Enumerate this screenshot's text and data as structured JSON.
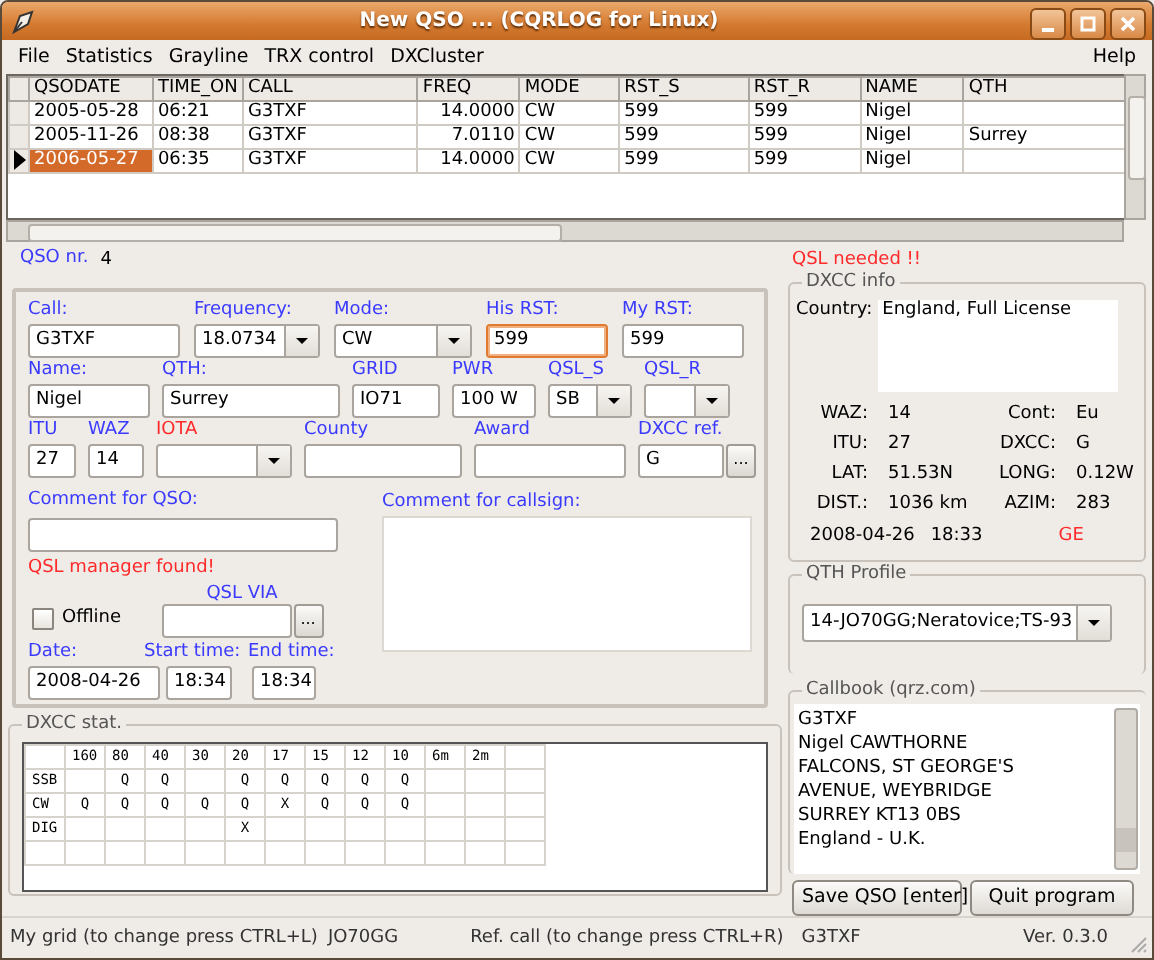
{
  "window": {
    "title": "New QSO ... (CQRLOG for Linux)"
  },
  "menu": {
    "items": [
      "File",
      "Statistics",
      "Grayline",
      "TRX control",
      "DXCluster"
    ],
    "right_items": [
      "Help"
    ]
  },
  "log_table": {
    "columns": [
      "QSODATE",
      "TIME_ON",
      "CALL",
      "FREQ",
      "MODE",
      "RST_S",
      "RST_R",
      "NAME",
      "QTH"
    ],
    "rows": [
      {
        "selected": false,
        "cells": [
          "2005-05-28",
          "06:21",
          "G3TXF",
          "14.0000",
          "CW",
          "599",
          "599",
          "Nigel",
          null
        ]
      },
      {
        "selected": false,
        "cells": [
          "2005-11-26",
          "08:38",
          "G3TXF",
          "7.0110",
          "CW",
          "599",
          "599",
          "Nigel",
          "Surrey"
        ]
      },
      {
        "selected": true,
        "cells": [
          "2006-05-27",
          "06:35",
          "G3TXF",
          "14.0000",
          "CW",
          "599",
          "599",
          "Nigel",
          null
        ]
      }
    ]
  },
  "qso_nr": {
    "label": "QSO nr.",
    "value": "4"
  },
  "qsl_notice": "QSL needed !!",
  "form": {
    "fields": [
      {
        "label": "Call:",
        "value": "G3TXF",
        "kind": "text",
        "focused": false,
        "warning": false
      },
      {
        "label": "Frequency:",
        "value": "18.0734",
        "kind": "combo",
        "focused": false,
        "warning": false
      },
      {
        "label": "Mode:",
        "value": "CW",
        "kind": "combo",
        "focused": false,
        "warning": false
      },
      {
        "label": "His RST:",
        "value": "599",
        "kind": "text",
        "focused": true,
        "warning": false
      },
      {
        "label": "My RST:",
        "value": "599",
        "kind": "text",
        "focused": false,
        "warning": false
      },
      {
        "label": "Name:",
        "value": "Nigel",
        "kind": "text",
        "focused": false,
        "warning": false
      },
      {
        "label": "QTH:",
        "value": "Surrey",
        "kind": "text",
        "focused": false,
        "warning": false
      },
      {
        "label": "GRID",
        "value": "IO71",
        "kind": "text",
        "focused": false,
        "warning": false
      },
      {
        "label": "PWR",
        "value": "100 W",
        "kind": "text",
        "focused": false,
        "warning": false
      },
      {
        "label": "QSL_S",
        "value": "SB",
        "kind": "combo",
        "focused": false,
        "warning": false
      },
      {
        "label": "QSL_R",
        "kind": "combo",
        "focused": false,
        "warning": false
      },
      {
        "label": "ITU",
        "value": "27",
        "kind": "text",
        "focused": false,
        "warning": false
      },
      {
        "label": "WAZ",
        "value": "14",
        "kind": "text",
        "focused": false,
        "warning": false
      },
      {
        "label": "IOTA",
        "kind": "combo",
        "focused": false,
        "warning": true
      },
      {
        "label": "County",
        "kind": "text",
        "focused": false,
        "warning": false
      },
      {
        "label": "Award",
        "kind": "text",
        "focused": false,
        "warning": false
      },
      {
        "label": "DXCC ref.",
        "value": "G",
        "kind": "picker",
        "button": "...",
        "focused": false,
        "warning": false
      }
    ],
    "comment_qso": {
      "label": "Comment for QSO:"
    },
    "qsl_manager_notice": "QSL manager found!",
    "offline": {
      "label": "Offline",
      "checked": false
    },
    "qsl_via": {
      "label": "QSL VIA",
      "button": "..."
    },
    "date": {
      "label": "Date:",
      "value": "2008-04-26"
    },
    "start_time": {
      "label": "Start time:",
      "value": "18:34"
    },
    "end_time": {
      "label": "End time:",
      "value": "18:34"
    },
    "comment_callsign": {
      "label": "Comment for callsign:"
    }
  },
  "dxcc_stat": {
    "title": "DXCC stat.",
    "columns": [
      "160",
      "80",
      "40",
      "30",
      "20",
      "17",
      "15",
      "12",
      "10",
      "6m",
      "2m"
    ],
    "rows": [
      {
        "mode": "SSB",
        "cells": [
          null,
          "Q",
          "Q",
          null,
          "Q",
          "Q",
          "Q",
          "Q",
          "Q",
          null,
          null
        ]
      },
      {
        "mode": "CW",
        "cells": [
          "Q",
          "Q",
          "Q",
          "Q",
          "Q",
          "X",
          "Q",
          "Q",
          "Q",
          null,
          null
        ]
      },
      {
        "mode": "DIG",
        "cells": [
          null,
          null,
          null,
          null,
          "X",
          null,
          null,
          null,
          null,
          null,
          null
        ]
      }
    ]
  },
  "dxcc_info": {
    "title": "DXCC info",
    "country_label": "Country:",
    "country": "England, Full License",
    "stats": [
      {
        "label": "WAZ:",
        "value": "14"
      },
      {
        "label": "Cont:",
        "value": "Eu"
      },
      {
        "label": "ITU:",
        "value": "27"
      },
      {
        "label": "DXCC:",
        "value": "G"
      },
      {
        "label": "LAT:",
        "value": "51.53N"
      },
      {
        "label": "LONG:",
        "value": "0.12W"
      },
      {
        "label": "DIST.:",
        "value": "1036 km"
      },
      {
        "label": "AZIM:",
        "value": "283"
      }
    ],
    "last_date": "2008-04-26",
    "last_time": "18:33",
    "flag_text": "GE"
  },
  "qth_profile": {
    "title": "QTH Profile",
    "value": "14-JO70GG;Neratovice;TS-93"
  },
  "callbook": {
    "title": "Callbook (qrz.com)",
    "lines": [
      "G3TXF",
      "Nigel CAWTHORNE",
      "FALCONS, ST GEORGE'S",
      "AVENUE, WEYBRIDGE",
      "SURREY KT13 0BS",
      "England - U.K."
    ]
  },
  "buttons": [
    "Save QSO [enter]",
    "Quit program"
  ],
  "status_bar": {
    "grid_label": "My grid (to change press CTRL+L)",
    "grid": "JO70GG",
    "ref_label": "Ref. call (to change press CTRL+R)",
    "ref_call": "G3TXF",
    "version": "Ver. 0.3.0"
  }
}
